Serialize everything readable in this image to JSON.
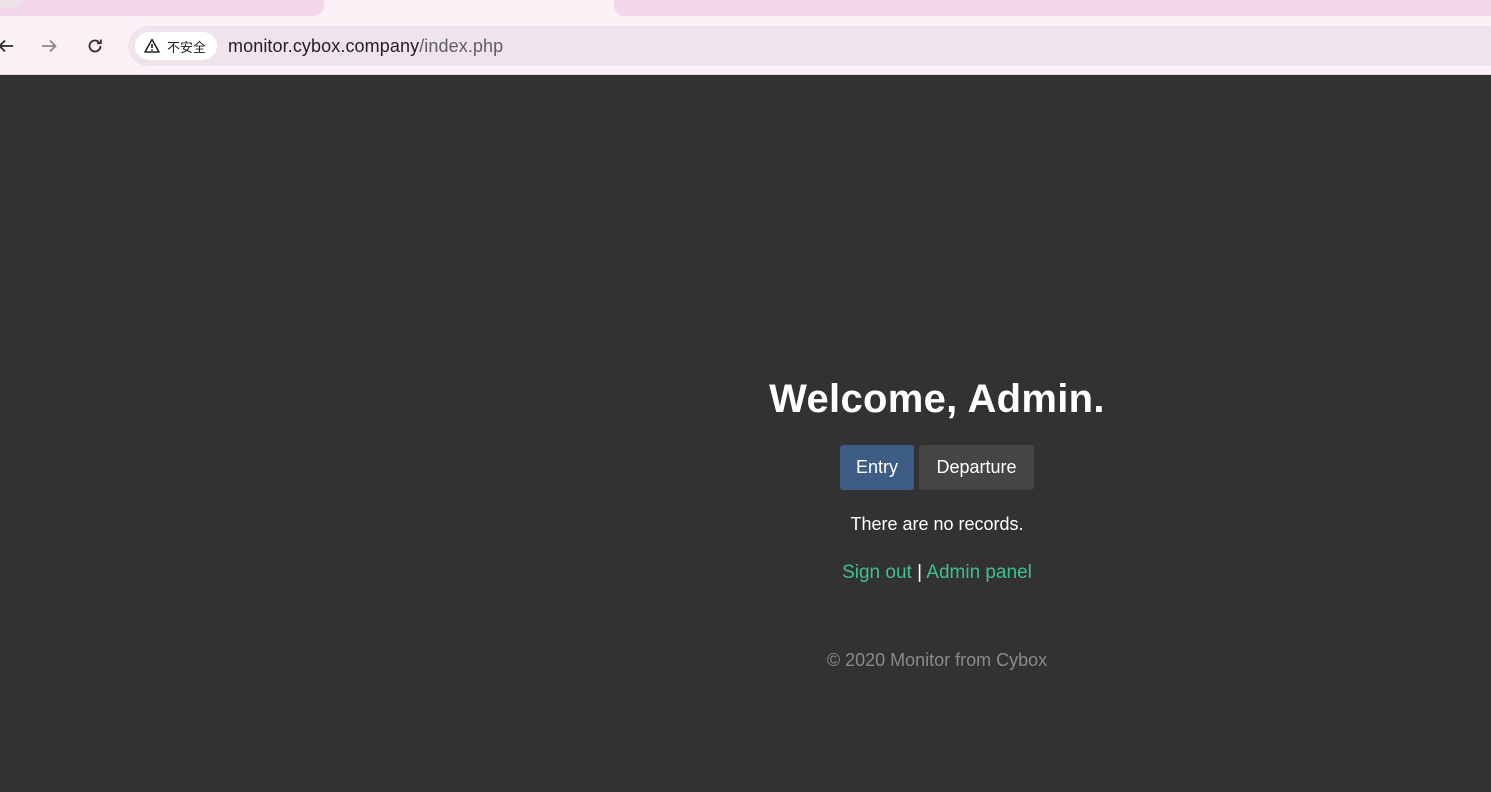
{
  "browser": {
    "security_label": "不安全",
    "url_host": "monitor.cybox.company",
    "url_path": "/index.php"
  },
  "page": {
    "welcome_prefix": "Welcome, ",
    "welcome_name": "Admin.",
    "entry_label": "Entry",
    "departure_label": "Departure",
    "no_records": "There are no records.",
    "sign_out_label": "Sign out",
    "link_separator": " | ",
    "admin_panel_label": "Admin panel",
    "footer": "© 2020 Monitor from Cybox",
    "colors": {
      "background": "#323232",
      "entry_button": "#3d5d87",
      "departure_button": "#454545",
      "link": "#3fc08d"
    }
  }
}
